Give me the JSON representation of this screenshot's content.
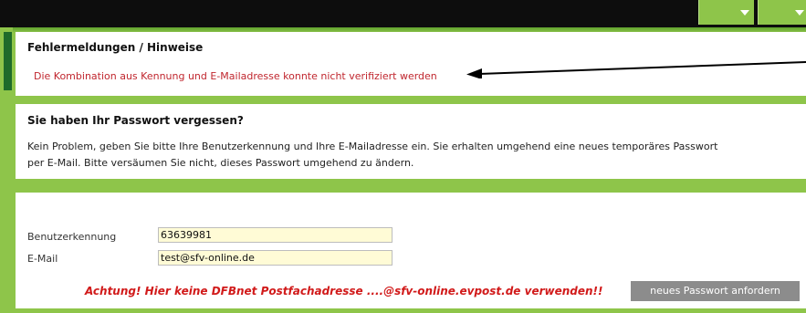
{
  "errors": {
    "heading": "Fehlermeldungen / Hinweise",
    "message": "Die Kombination aus Kennung und E-Mailadresse konnte nicht verifiziert werden"
  },
  "forgot": {
    "heading": "Sie haben Ihr Passwort vergessen?",
    "line1": "Kein Problem, geben Sie bitte Ihre Benutzerkennung und Ihre E-Mailadresse ein. Sie erhalten umgehend eine neues temporäres Passwort",
    "line2": "per E-Mail. Bitte versäumen Sie nicht, dieses Passwort umgehend zu ändern."
  },
  "form": {
    "username_label": "Benutzerkennung",
    "username_value": "63639981",
    "email_label": "E-Mail",
    "email_value": "test@sfv-online.de",
    "warning": "Achtung! Hier keine DFBnet Postfachadresse ....@sfv-online.evpost.de verwenden!!",
    "submit_label": "neues Passwort anfordern"
  },
  "colors": {
    "accent_green": "#8ec54a",
    "error_red": "#c0262e",
    "warning_red": "#d11a1a",
    "input_bg": "#fffbd6",
    "button_gray": "#8c8c8c"
  },
  "icons": [
    "chevron-down-icon",
    "chevron-down-icon",
    "arrow-pointer"
  ]
}
